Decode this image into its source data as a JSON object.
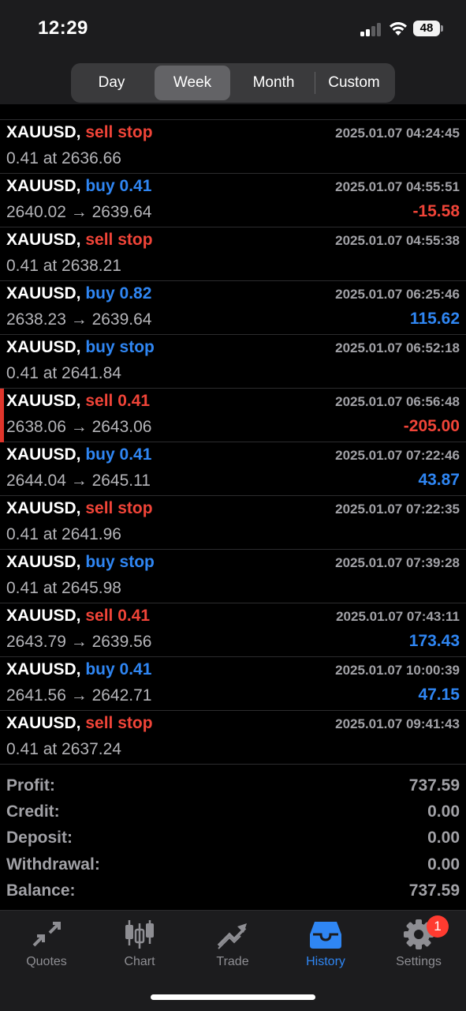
{
  "status_bar": {
    "time": "12:29",
    "battery": "48"
  },
  "period_tabs": [
    {
      "label": "Day",
      "active": false
    },
    {
      "label": "Week",
      "active": true
    },
    {
      "label": "Month",
      "active": false
    },
    {
      "label": "Custom",
      "active": false
    }
  ],
  "deals": [
    {
      "symbol": "XAUUSD,",
      "action": "sell stop",
      "side": "sell",
      "datetime": "2025.01.07 04:24:45",
      "prices": "0.41 at 2636.66",
      "profit": ""
    },
    {
      "symbol": "XAUUSD,",
      "action": "buy 0.41",
      "side": "buy",
      "datetime": "2025.01.07 04:55:51",
      "prices": "2640.02 → 2639.64",
      "profit": "-15.58"
    },
    {
      "symbol": "XAUUSD,",
      "action": "sell stop",
      "side": "sell",
      "datetime": "2025.01.07 04:55:38",
      "prices": "0.41 at 2638.21",
      "profit": ""
    },
    {
      "symbol": "XAUUSD,",
      "action": "buy 0.82",
      "side": "buy",
      "datetime": "2025.01.07 06:25:46",
      "prices": "2638.23 → 2639.64",
      "profit": "115.62"
    },
    {
      "symbol": "XAUUSD,",
      "action": "buy stop",
      "side": "buy",
      "datetime": "2025.01.07 06:52:18",
      "prices": "0.41 at 2641.84",
      "profit": ""
    },
    {
      "symbol": "XAUUSD,",
      "action": "sell 0.41",
      "side": "sell",
      "datetime": "2025.01.07 06:56:48",
      "prices": "2638.06 → 2643.06",
      "profit": "-205.00"
    },
    {
      "symbol": "XAUUSD,",
      "action": "buy 0.41",
      "side": "buy",
      "datetime": "2025.01.07 07:22:46",
      "prices": "2644.04 → 2645.11",
      "profit": "43.87"
    },
    {
      "symbol": "XAUUSD,",
      "action": "sell stop",
      "side": "sell",
      "datetime": "2025.01.07 07:22:35",
      "prices": "0.41 at 2641.96",
      "profit": ""
    },
    {
      "symbol": "XAUUSD,",
      "action": "buy stop",
      "side": "buy",
      "datetime": "2025.01.07 07:39:28",
      "prices": "0.41 at 2645.98",
      "profit": ""
    },
    {
      "symbol": "XAUUSD,",
      "action": "sell 0.41",
      "side": "sell",
      "datetime": "2025.01.07 07:43:11",
      "prices": "2643.79 → 2639.56",
      "profit": "173.43"
    },
    {
      "symbol": "XAUUSD,",
      "action": "buy 0.41",
      "side": "buy",
      "datetime": "2025.01.07 10:00:39",
      "prices": "2641.56 → 2642.71",
      "profit": "47.15"
    },
    {
      "symbol": "XAUUSD,",
      "action": "sell stop",
      "side": "sell",
      "datetime": "2025.01.07 09:41:43",
      "prices": "0.41 at 2637.24",
      "profit": ""
    }
  ],
  "summary": [
    {
      "label": "Profit:",
      "value": "737.59"
    },
    {
      "label": "Credit:",
      "value": "0.00"
    },
    {
      "label": "Deposit:",
      "value": "0.00"
    },
    {
      "label": "Withdrawal:",
      "value": "0.00"
    },
    {
      "label": "Balance:",
      "value": "737.59"
    }
  ],
  "tab_bar": [
    {
      "label": "Quotes",
      "icon": "quotes-icon",
      "active": false
    },
    {
      "label": "Chart",
      "icon": "chart-icon",
      "active": false
    },
    {
      "label": "Trade",
      "icon": "trade-icon",
      "active": false
    },
    {
      "label": "History",
      "icon": "history-icon",
      "active": true
    },
    {
      "label": "Settings",
      "icon": "settings-icon",
      "active": false,
      "badge": "1"
    }
  ],
  "colors": {
    "sell": "#f04438",
    "buy": "#2f86f3",
    "active_tab": "#2f86f3",
    "badge": "#ff3b30"
  }
}
